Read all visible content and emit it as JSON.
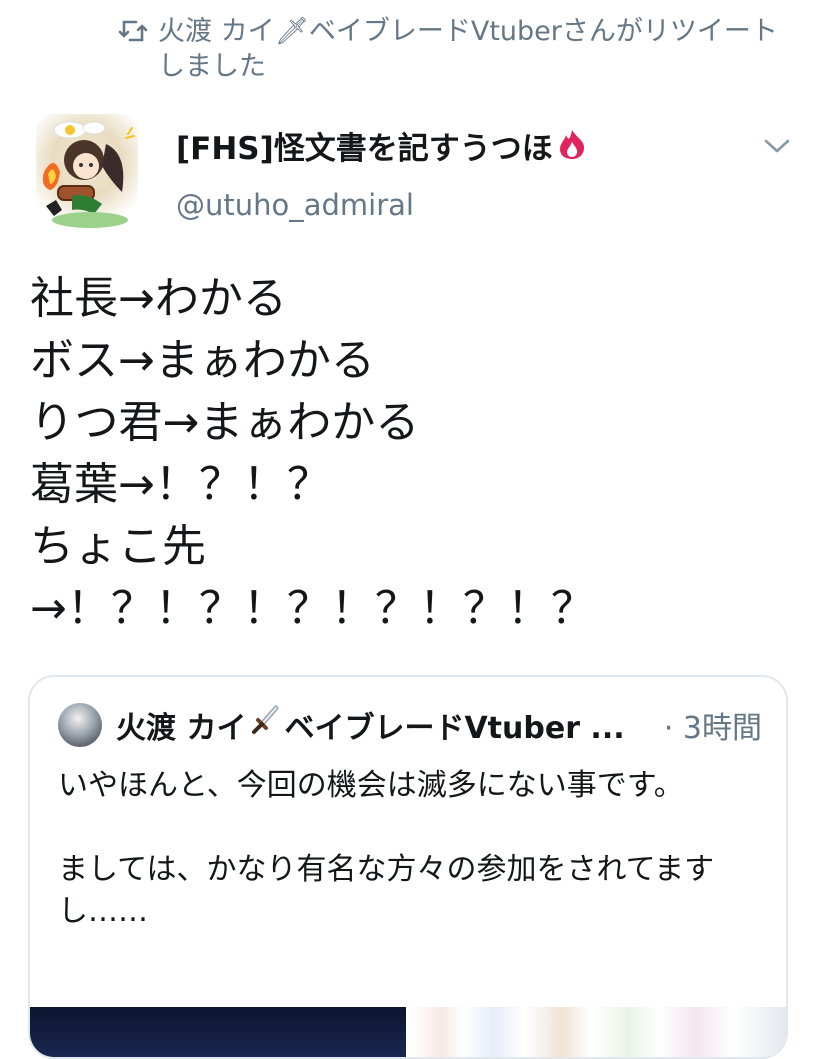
{
  "retweet": {
    "icon": "retweet-icon",
    "text": "火渡 カイ🗡ベイブレードVtuberさんがリツイートしました"
  },
  "author": {
    "avatar": "avatar-illustration",
    "display_name": "[FHS]怪文書を記すうつほ",
    "name_emoji": "fire-emoji",
    "handle": "@utuho_admiral",
    "menu_icon": "chevron-down-icon"
  },
  "tweet": {
    "text": "社長→わかる\nボス→まぁわかる\nりつ君→まぁわかる\n葛葉→！？！？\nちょこ先\n→！？！？！？！？！？！？"
  },
  "quote": {
    "author_name": "火渡 カイ",
    "author_name_suffix": "ベイブレードVtuber ...",
    "dagger_icon": "dagger-icon",
    "time": "· 3時間",
    "text": "いやほんと、今回の機会は滅多にない事です。\n\nましては、かなり有名な方々の参加をされてますし……"
  },
  "colors": {
    "secondary_text": "#657786",
    "primary_text": "#14171a",
    "border": "#e1e8ed",
    "fire": "#e0245e"
  }
}
